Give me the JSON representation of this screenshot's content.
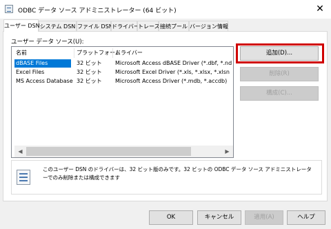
{
  "window": {
    "title": "ODBC データ ソース アドミニストレーター (64 ビット)",
    "close_glyph": "✕"
  },
  "tabs": [
    {
      "label": "ユーザー DSN",
      "active": true
    },
    {
      "label": "システム DSN"
    },
    {
      "label": "ファイル DSN"
    },
    {
      "label": "ドライバー"
    },
    {
      "label": "トレース"
    },
    {
      "label": "接続プール"
    },
    {
      "label": "バージョン情報"
    }
  ],
  "list": {
    "label": "ユーザー データ ソース(U):",
    "columns": [
      "名前",
      "プラットフォーム",
      "ドライバー"
    ],
    "rows": [
      {
        "name": "dBASE Files",
        "platform": "32 ビット",
        "driver": "Microsoft Access dBASE Driver (*.dbf, *.nd",
        "selected": true
      },
      {
        "name": "Excel Files",
        "platform": "32 ビット",
        "driver": "Microsoft Excel Driver (*.xls, *.xlsx, *.xlsn"
      },
      {
        "name": "MS Access Database",
        "platform": "32 ビット",
        "driver": "Microsoft Access Driver (*.mdb, *.accdb)"
      }
    ],
    "scroll_left_glyph": "◀",
    "scroll_right_glyph": "▶"
  },
  "side_buttons": {
    "add": "追加(D)...",
    "remove": "削除(R)",
    "configure": "構成(C)..."
  },
  "info": {
    "icon": "data-source-icon",
    "text": "このユーザー DSN のドライバーは、32 ビット版のみです。32 ビットの ODBC データ ソース アドミニストレーターでのみ削除または構成できます"
  },
  "footer": {
    "ok": "OK",
    "cancel": "キャンセル",
    "apply": "適用(A)",
    "help": "ヘルプ"
  },
  "colors": {
    "selection": "#0078d7",
    "highlight": "#d00000"
  }
}
